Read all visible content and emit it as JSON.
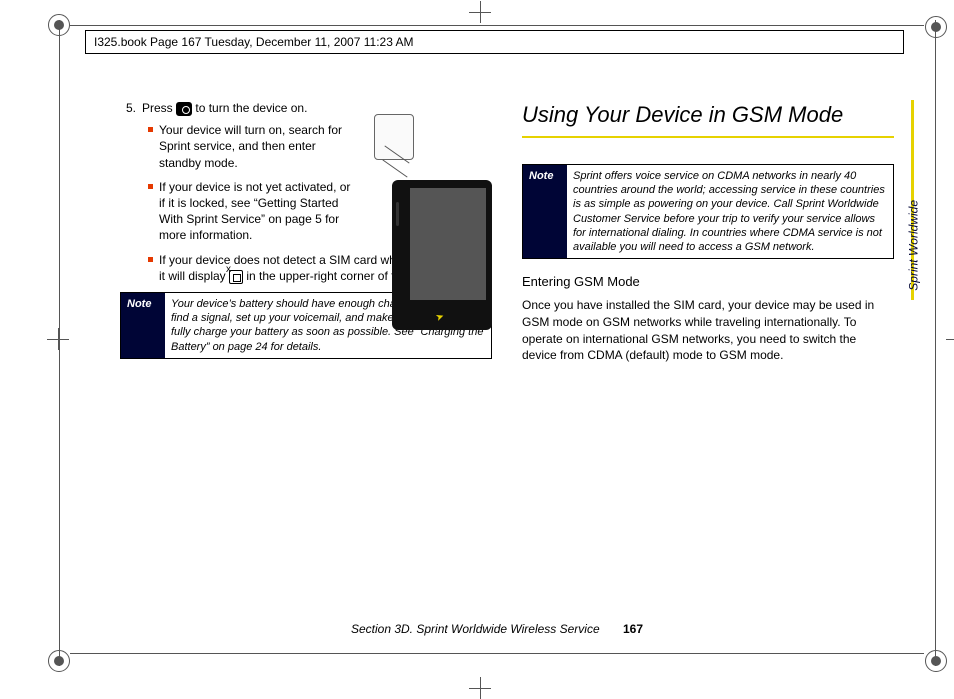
{
  "runhead": "I325.book  Page 167  Tuesday, December 11, 2007  11:23 AM",
  "left": {
    "step_num": "5.",
    "step_text_a": "Press ",
    "step_text_b": " to turn the device on.",
    "bullets": [
      "Your device will turn on, search for Sprint service, and then enter standby mode.",
      "If your device is not yet activated, or if it is locked, see “Getting Started With Sprint Service” on page 5 for more information."
    ],
    "bullet3_a": "If your device does not detect a SIM card while in GSM mode, it will display ",
    "bullet3_b": " in the upper-right corner of the Home screen."
  },
  "note1": {
    "label": "Note",
    "body": "Your device’s battery should have enough charge to turn on, find a signal, set up your voicemail, and make a call. You should fully charge your battery as soon as possible. See “Charging the Battery” on page 24 for details."
  },
  "right": {
    "h1": "Using Your Device in GSM Mode",
    "note": {
      "label": "Note",
      "body": "Sprint offers voice service on CDMA networks in nearly 40 countries around the world; accessing service in these countries is as simple as powering on your device. Call Sprint Worldwide Customer Service before your trip to verify your service allows for international dialing. In countries where CDMA service is not available you will need to access a GSM network."
    },
    "h2": "Entering GSM Mode",
    "para": "Once you have installed the SIM card, your device may be used in GSM mode on GSM networks while traveling internationally. To operate on international GSM networks, you need to switch the device from CDMA (default) mode to GSM mode."
  },
  "side_tab": "Sprint Worldwide",
  "footer": {
    "section": "Section 3D. Sprint Worldwide Wireless Service",
    "page": "167"
  }
}
